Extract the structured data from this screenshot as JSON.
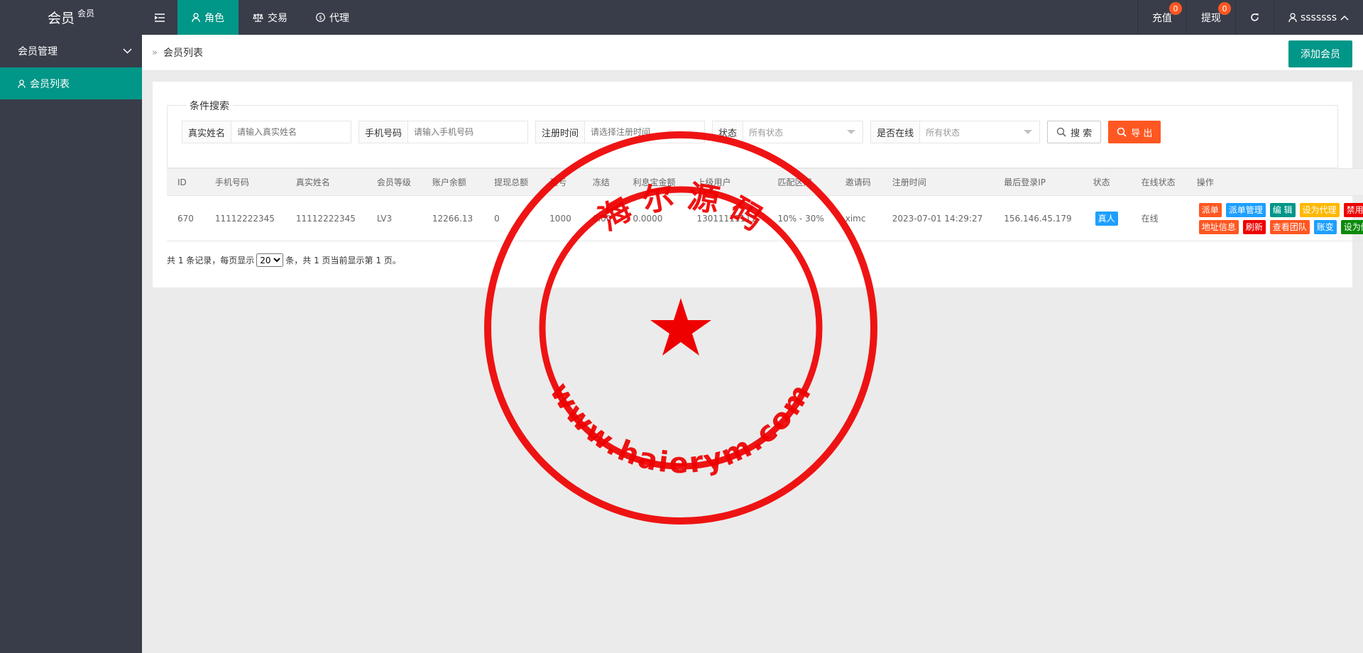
{
  "app": {
    "logo": "会员",
    "logo_sup": "会员"
  },
  "topnav": {
    "items": [
      {
        "label": "角色",
        "icon": "user-icon",
        "active": true
      },
      {
        "label": "交易",
        "icon": "scale-icon"
      },
      {
        "label": "代理",
        "icon": "dollar-icon"
      }
    ]
  },
  "topright": {
    "recharge": {
      "label": "充值",
      "badge": "0"
    },
    "withdraw": {
      "label": "提现",
      "badge": "0"
    },
    "user": "sssssss"
  },
  "sidebar": {
    "group": "会员管理",
    "items": [
      {
        "label": "会员列表",
        "active": true
      }
    ]
  },
  "breadcrumb": {
    "current": "会员列表"
  },
  "add_button": "添加会员",
  "search": {
    "legend": "条件搜索",
    "fields": [
      {
        "label": "真实姓名",
        "placeholder": "请输入真实姓名"
      },
      {
        "label": "手机号码",
        "placeholder": "请输入手机号码"
      },
      {
        "label": "注册时间",
        "placeholder": "请选择注册时间"
      },
      {
        "label": "状态",
        "value": "所有状态"
      },
      {
        "label": "是否在线",
        "value": "所有状态"
      }
    ],
    "search_button": "搜 索",
    "export_button": "导 出"
  },
  "table": {
    "columns": [
      "ID",
      "手机号码",
      "真实姓名",
      "会员等级",
      "账户余额",
      "提现总额",
      "盈亏",
      "冻结",
      "利息宝金额",
      "上级用户",
      "匹配区间",
      "邀请码",
      "注册时间",
      "最后登录IP",
      "状态",
      "在线状态",
      "操作"
    ],
    "rows": [
      {
        "id": "670",
        "phone": "11112222345",
        "name": "11112222345",
        "level": "LV3",
        "balance": "12266.13",
        "withdraw_total": "0",
        "profit": "1000",
        "frozen": "0.00",
        "interest": "0.0000",
        "parent": "13011111111",
        "range": "10% - 30%",
        "invite": "ximc",
        "reg_time": "2023-07-01 14:29:27",
        "last_ip": "156.146.45.179",
        "status": "真人",
        "online": "在线",
        "actions_line1": [
          {
            "label": "派单",
            "color": "#ff5722"
          },
          {
            "label": "派单管理",
            "color": "#1e9fff"
          },
          {
            "label": "编 辑",
            "color": "#009688"
          },
          {
            "label": "设为代理",
            "color": "#ffb800"
          },
          {
            "label": "禁用",
            "color": "#ee0000"
          }
        ],
        "actions_line2": [
          {
            "label": "地址信息",
            "color": "#ff5722"
          },
          {
            "label": "刷新",
            "color": "#ee0000"
          },
          {
            "label": "查看团队",
            "color": "#ff5722"
          },
          {
            "label": "账变",
            "color": "#1e9fff"
          },
          {
            "label": "设为假",
            "color": "#0a8a0a"
          }
        ]
      }
    ]
  },
  "pager": {
    "prefix": "共 1 条记录，每页显示",
    "page_size": "20",
    "suffix": "条，共 1 页当前显示第 1 页。"
  },
  "watermark": {
    "top_text": "海 尔 源 码",
    "bottom_text": "www.haierym.com",
    "color": "#ee0000"
  }
}
